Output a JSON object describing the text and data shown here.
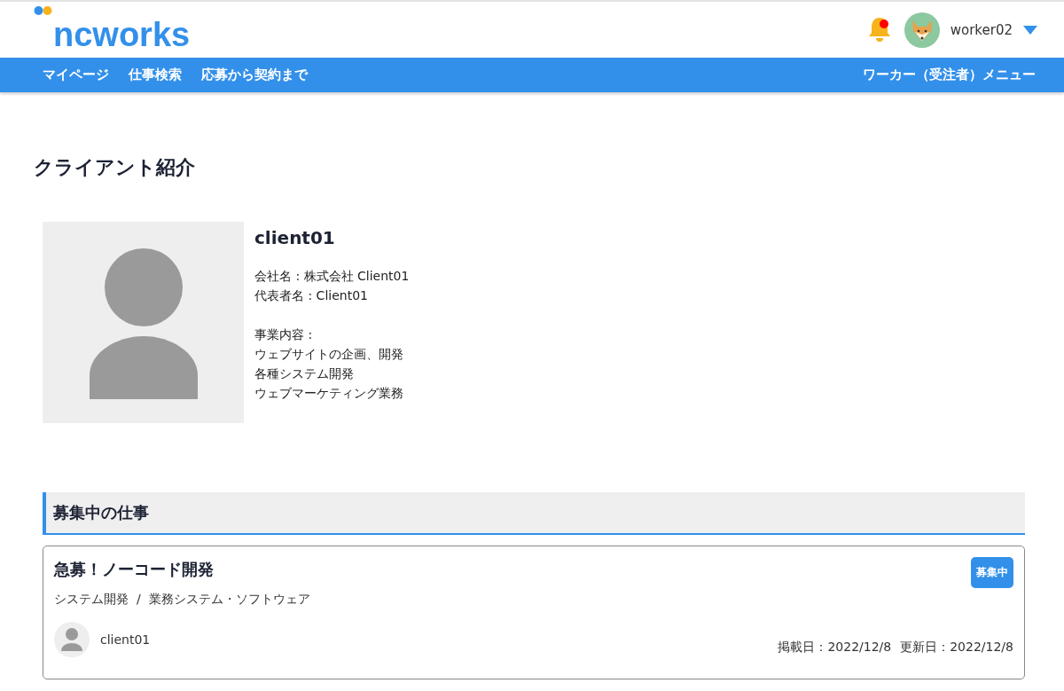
{
  "header": {
    "logo": "ncworks",
    "notifications": {
      "unread": true
    },
    "user": {
      "name": "worker02"
    }
  },
  "nav": {
    "items": [
      "マイページ",
      "仕事検索",
      "応募から契約まで"
    ],
    "menu": "ワーカー（受注者）メニュー"
  },
  "page_title": "クライアント紹介",
  "client": {
    "name": "client01",
    "company": "会社名 : 株式会社 Client01",
    "representative": "代表者名 : Client01",
    "business_label": "事業内容 :",
    "business": [
      "ウェブサイトの企画、開発",
      "各種システム開発",
      "ウェブマーケティング業務"
    ]
  },
  "jobs_section": {
    "title": "募集中の仕事",
    "jobs": [
      {
        "title": "急募！ノーコード開発",
        "status": "募集中",
        "category": "システム開発  /  業務システム・ソフトウェア",
        "client": "client01",
        "posted": "掲載日：2022/12/8",
        "updated": "更新日：2022/12/8"
      }
    ]
  }
}
